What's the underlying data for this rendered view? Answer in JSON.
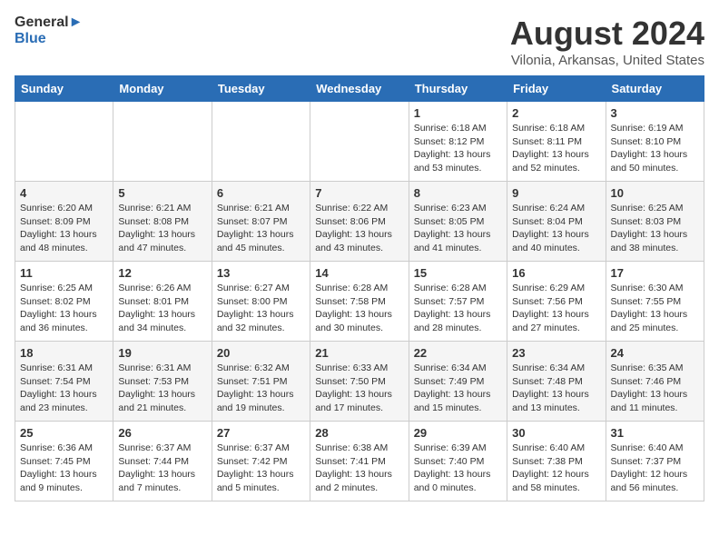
{
  "header": {
    "logo_line1": "General",
    "logo_line2": "Blue",
    "title": "August 2024",
    "subtitle": "Vilonia, Arkansas, United States"
  },
  "weekdays": [
    "Sunday",
    "Monday",
    "Tuesday",
    "Wednesday",
    "Thursday",
    "Friday",
    "Saturday"
  ],
  "weeks": [
    [
      {
        "day": "",
        "info": ""
      },
      {
        "day": "",
        "info": ""
      },
      {
        "day": "",
        "info": ""
      },
      {
        "day": "",
        "info": ""
      },
      {
        "day": "1",
        "info": "Sunrise: 6:18 AM\nSunset: 8:12 PM\nDaylight: 13 hours\nand 53 minutes."
      },
      {
        "day": "2",
        "info": "Sunrise: 6:18 AM\nSunset: 8:11 PM\nDaylight: 13 hours\nand 52 minutes."
      },
      {
        "day": "3",
        "info": "Sunrise: 6:19 AM\nSunset: 8:10 PM\nDaylight: 13 hours\nand 50 minutes."
      }
    ],
    [
      {
        "day": "4",
        "info": "Sunrise: 6:20 AM\nSunset: 8:09 PM\nDaylight: 13 hours\nand 48 minutes."
      },
      {
        "day": "5",
        "info": "Sunrise: 6:21 AM\nSunset: 8:08 PM\nDaylight: 13 hours\nand 47 minutes."
      },
      {
        "day": "6",
        "info": "Sunrise: 6:21 AM\nSunset: 8:07 PM\nDaylight: 13 hours\nand 45 minutes."
      },
      {
        "day": "7",
        "info": "Sunrise: 6:22 AM\nSunset: 8:06 PM\nDaylight: 13 hours\nand 43 minutes."
      },
      {
        "day": "8",
        "info": "Sunrise: 6:23 AM\nSunset: 8:05 PM\nDaylight: 13 hours\nand 41 minutes."
      },
      {
        "day": "9",
        "info": "Sunrise: 6:24 AM\nSunset: 8:04 PM\nDaylight: 13 hours\nand 40 minutes."
      },
      {
        "day": "10",
        "info": "Sunrise: 6:25 AM\nSunset: 8:03 PM\nDaylight: 13 hours\nand 38 minutes."
      }
    ],
    [
      {
        "day": "11",
        "info": "Sunrise: 6:25 AM\nSunset: 8:02 PM\nDaylight: 13 hours\nand 36 minutes."
      },
      {
        "day": "12",
        "info": "Sunrise: 6:26 AM\nSunset: 8:01 PM\nDaylight: 13 hours\nand 34 minutes."
      },
      {
        "day": "13",
        "info": "Sunrise: 6:27 AM\nSunset: 8:00 PM\nDaylight: 13 hours\nand 32 minutes."
      },
      {
        "day": "14",
        "info": "Sunrise: 6:28 AM\nSunset: 7:58 PM\nDaylight: 13 hours\nand 30 minutes."
      },
      {
        "day": "15",
        "info": "Sunrise: 6:28 AM\nSunset: 7:57 PM\nDaylight: 13 hours\nand 28 minutes."
      },
      {
        "day": "16",
        "info": "Sunrise: 6:29 AM\nSunset: 7:56 PM\nDaylight: 13 hours\nand 27 minutes."
      },
      {
        "day": "17",
        "info": "Sunrise: 6:30 AM\nSunset: 7:55 PM\nDaylight: 13 hours\nand 25 minutes."
      }
    ],
    [
      {
        "day": "18",
        "info": "Sunrise: 6:31 AM\nSunset: 7:54 PM\nDaylight: 13 hours\nand 23 minutes."
      },
      {
        "day": "19",
        "info": "Sunrise: 6:31 AM\nSunset: 7:53 PM\nDaylight: 13 hours\nand 21 minutes."
      },
      {
        "day": "20",
        "info": "Sunrise: 6:32 AM\nSunset: 7:51 PM\nDaylight: 13 hours\nand 19 minutes."
      },
      {
        "day": "21",
        "info": "Sunrise: 6:33 AM\nSunset: 7:50 PM\nDaylight: 13 hours\nand 17 minutes."
      },
      {
        "day": "22",
        "info": "Sunrise: 6:34 AM\nSunset: 7:49 PM\nDaylight: 13 hours\nand 15 minutes."
      },
      {
        "day": "23",
        "info": "Sunrise: 6:34 AM\nSunset: 7:48 PM\nDaylight: 13 hours\nand 13 minutes."
      },
      {
        "day": "24",
        "info": "Sunrise: 6:35 AM\nSunset: 7:46 PM\nDaylight: 13 hours\nand 11 minutes."
      }
    ],
    [
      {
        "day": "25",
        "info": "Sunrise: 6:36 AM\nSunset: 7:45 PM\nDaylight: 13 hours\nand 9 minutes."
      },
      {
        "day": "26",
        "info": "Sunrise: 6:37 AM\nSunset: 7:44 PM\nDaylight: 13 hours\nand 7 minutes."
      },
      {
        "day": "27",
        "info": "Sunrise: 6:37 AM\nSunset: 7:42 PM\nDaylight: 13 hours\nand 5 minutes."
      },
      {
        "day": "28",
        "info": "Sunrise: 6:38 AM\nSunset: 7:41 PM\nDaylight: 13 hours\nand 2 minutes."
      },
      {
        "day": "29",
        "info": "Sunrise: 6:39 AM\nSunset: 7:40 PM\nDaylight: 13 hours\nand 0 minutes."
      },
      {
        "day": "30",
        "info": "Sunrise: 6:40 AM\nSunset: 7:38 PM\nDaylight: 12 hours\nand 58 minutes."
      },
      {
        "day": "31",
        "info": "Sunrise: 6:40 AM\nSunset: 7:37 PM\nDaylight: 12 hours\nand 56 minutes."
      }
    ]
  ]
}
